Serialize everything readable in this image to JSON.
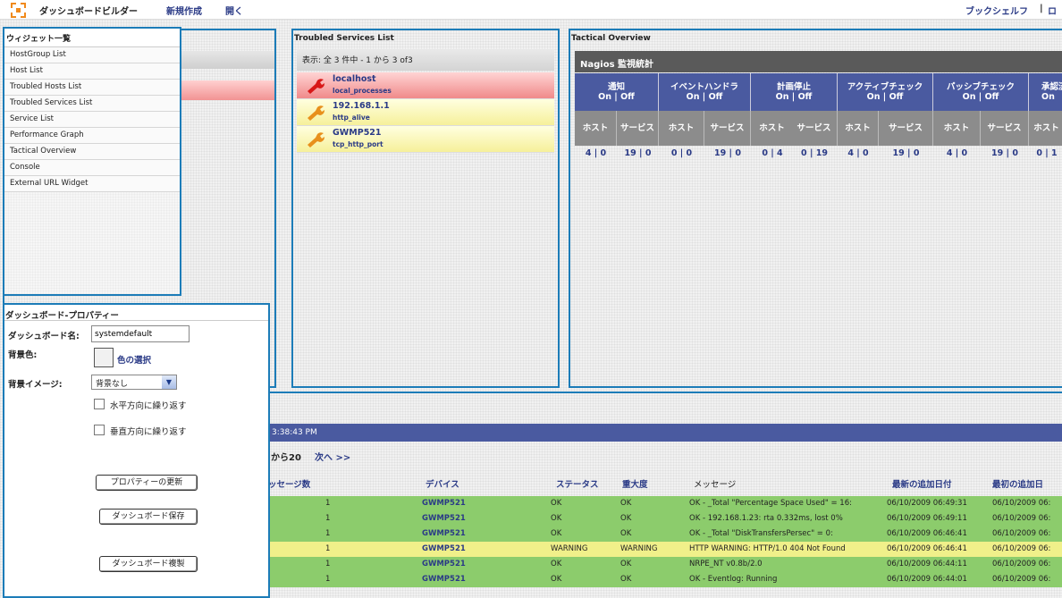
{
  "topbar": {
    "title": "ダッシュボードビルダー",
    "new": "新規作成",
    "open": "開く",
    "bookshelf": "ブックシェルフ",
    "sep": "|",
    "logout": "ロ"
  },
  "palette": {
    "title": "ウィジェット一覧",
    "items": [
      "HostGroup List",
      "Host List",
      "Troubled Hosts List",
      "Troubled Services List",
      "Service List",
      "Performance Graph",
      "Tactical Overview",
      "Console",
      "External URL Widget"
    ]
  },
  "troubled_services": {
    "title": "Troubled Services List",
    "summary": "表示: 全 3 件中 - 1 から 3 of3",
    "items": [
      {
        "host": "localhost",
        "service": "local_processes"
      },
      {
        "host": "192.168.1.1",
        "service": "http_alive"
      },
      {
        "host": "GWMP521",
        "service": "tcp_http_port"
      }
    ]
  },
  "tactical": {
    "title": "Tactical Overview",
    "heading": "Nagios 監視統計",
    "groups": [
      {
        "name": "通知",
        "toggle": "On | Off"
      },
      {
        "name": "イベントハンドラ",
        "toggle": "On | Off"
      },
      {
        "name": "計画停止",
        "toggle": "On | Off"
      },
      {
        "name": "アクティブチェック",
        "toggle": "On | Off"
      },
      {
        "name": "パッシブチェック",
        "toggle": "On | Off"
      },
      {
        "name": "承認済",
        "toggle": "On"
      }
    ],
    "sub": [
      "ホスト",
      "サービス",
      "ホスト",
      "サービス",
      "ホスト",
      "サービス",
      "ホスト",
      "サービス",
      "ホスト",
      "サービス",
      "ホスト"
    ],
    "values": [
      "4 | 0",
      "19 | 0",
      "0 | 0",
      "19 | 0",
      "0 | 4",
      "0 | 19",
      "4 | 0",
      "19 | 0",
      "4 | 0",
      "19 | 0",
      "0 | 1"
    ]
  },
  "properties": {
    "title": "ダッシュボード-プロパティー",
    "name_label": "ダッシュボード名:",
    "name_value": "systemdefault",
    "bg_color_label": "背景色:",
    "color_select": "色の選択",
    "bg_image_label": "背景イメージ:",
    "bg_image_value": "背景なし",
    "repeat_h": "水平方向に繰り返す",
    "repeat_v": "垂直方向に繰り返す",
    "update_btn": "プロパティーの更新",
    "save_btn": "ダッシュボード保存",
    "copy_btn": "ダッシュボード複製"
  },
  "console": {
    "time": "3:38:43 PM",
    "paging": "から20",
    "next": "次へ >>",
    "headers": [
      "ッセージ数",
      "デバイス",
      "ステータス",
      "重大度",
      "メッセージ",
      "最新の追加日付",
      "最初の追加日"
    ],
    "rows": [
      {
        "count": "1",
        "device": "GWMP521",
        "status": "OK",
        "severity": "OK",
        "message": "OK - _Total \"Percentage Space Used\" = 16:",
        "last": "06/10/2009 06:49:31",
        "first": "06/10/2009 06:",
        "color": "#8ccc6c"
      },
      {
        "count": "1",
        "device": "GWMP521",
        "status": "OK",
        "severity": "OK",
        "message": "OK - 192.168.1.23: rta 0.332ms, lost 0%",
        "last": "06/10/2009 06:49:11",
        "first": "06/10/2009 06:",
        "color": "#8ccc6c"
      },
      {
        "count": "1",
        "device": "GWMP521",
        "status": "OK",
        "severity": "OK",
        "message": "OK - _Total \"DiskTransfersPersec\" = 0:",
        "last": "06/10/2009 06:46:41",
        "first": "06/10/2009 06:",
        "color": "#8ccc6c"
      },
      {
        "count": "1",
        "device": "GWMP521",
        "status": "WARNING",
        "severity": "WARNING",
        "message": "HTTP WARNING: HTTP/1.0 404 Not Found",
        "last": "06/10/2009 06:46:41",
        "first": "06/10/2009 06:",
        "color": "#f0f08a"
      },
      {
        "count": "1",
        "device": "GWMP521",
        "status": "OK",
        "severity": "OK",
        "message": "NRPE_NT v0.8b/2.0",
        "last": "06/10/2009 06:44:11",
        "first": "06/10/2009 06:",
        "color": "#8ccc6c"
      },
      {
        "count": "1",
        "device": "GWMP521",
        "status": "OK",
        "severity": "OK",
        "message": "OK - Eventlog: Running",
        "last": "06/10/2009 06:44:01",
        "first": "06/10/2009 06:",
        "color": "#8ccc6c"
      }
    ]
  }
}
